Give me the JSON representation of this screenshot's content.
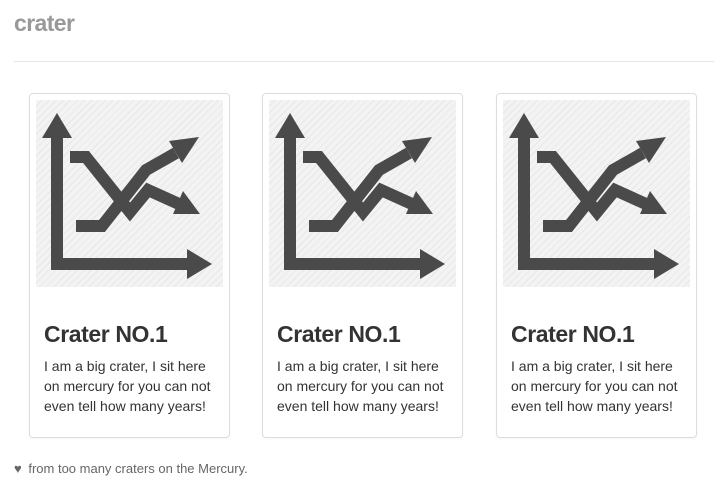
{
  "header": {
    "brand": "crater"
  },
  "cards": [
    {
      "image_icon": "chart-crossing-arrows-icon",
      "title": "Crater NO.1",
      "text": "I am a big crater, I sit here on mercury for you can not even tell how many years!"
    },
    {
      "image_icon": "chart-crossing-arrows-icon",
      "title": "Crater NO.1",
      "text": "I am a big crater, I sit here on mercury for you can not even tell how many years!"
    },
    {
      "image_icon": "chart-crossing-arrows-icon",
      "title": "Crater NO.1",
      "text": "I am a big crater, I sit here on mercury for you can not even tell how many years!"
    }
  ],
  "footer": {
    "heart": "♥",
    "text": "from too many craters on the Mercury."
  },
  "colors": {
    "brand": "#999999",
    "icon": "#4a4a4a",
    "card_border": "#dddddd",
    "text": "#333333"
  }
}
